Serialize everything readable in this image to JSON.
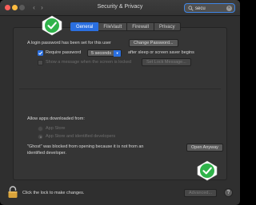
{
  "window": {
    "title": "Security & Privacy"
  },
  "search": {
    "value": "secu"
  },
  "tabs": [
    {
      "label": "General",
      "active": true
    },
    {
      "label": "FileVault",
      "active": false
    },
    {
      "label": "Firewall",
      "active": false
    },
    {
      "label": "Privacy",
      "active": false
    }
  ],
  "general": {
    "password_set_text": "A login password has been set for this user",
    "change_password_label": "Change Password...",
    "require_password_label": "Require password",
    "require_password_checked": true,
    "delay_value": "5 seconds",
    "after_sleep_text": "after sleep or screen saver begins",
    "show_message_label": "Show a message when the screen is locked",
    "show_message_checked": false,
    "set_lock_message_label": "Set Lock Message..."
  },
  "downloads": {
    "heading": "Allow apps downloaded from:",
    "options": [
      {
        "label": "App Store",
        "selected": false
      },
      {
        "label": "App Store and identified developers",
        "selected": true
      }
    ],
    "blocked_line1": "\"Ghost\" was blocked from opening because it is not from an",
    "blocked_line2": "identified developer.",
    "open_anyway_label": "Open Anyway"
  },
  "footer": {
    "lock_text": "Click the lock to make changes.",
    "advanced_label": "Advanced...",
    "help_label": "?"
  },
  "colors": {
    "accent": "#2a6fe0",
    "badge_green": "#2fb34a",
    "lock_gold": "#d9a33a"
  }
}
